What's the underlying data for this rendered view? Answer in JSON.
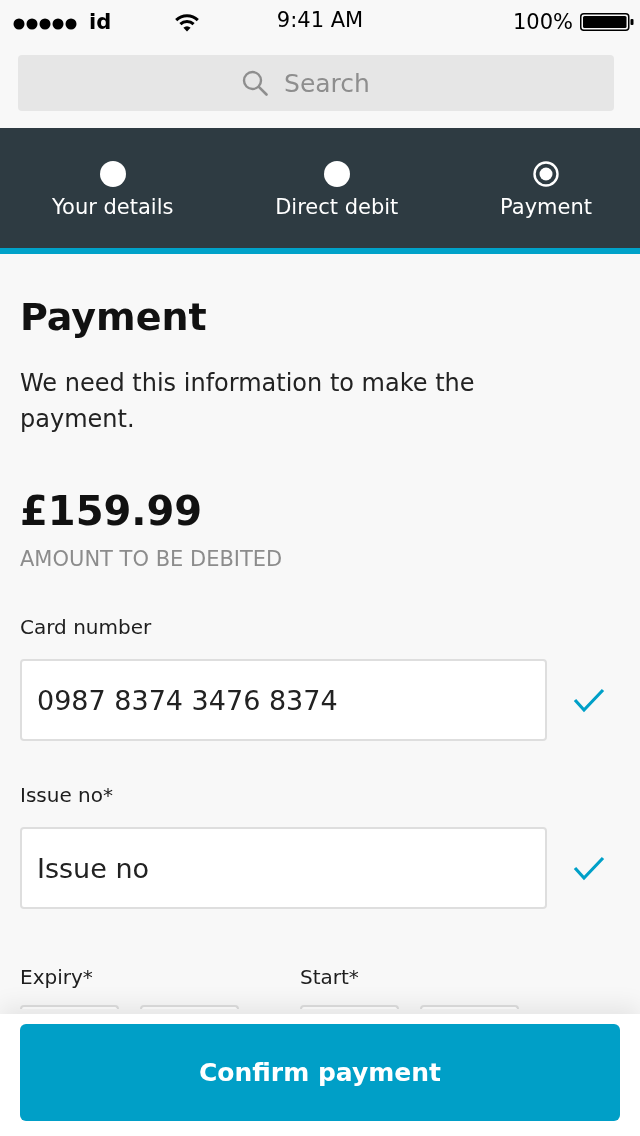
{
  "status_bar": {
    "carrier": "id",
    "time": "9:41 AM",
    "battery": "100%"
  },
  "search": {
    "placeholder": "Search"
  },
  "steps": [
    {
      "label": "Your details",
      "selected": false
    },
    {
      "label": "Direct debit",
      "selected": false
    },
    {
      "label": "Payment",
      "selected": true
    }
  ],
  "page": {
    "title": "Payment",
    "description": "We need this information to make the payment.",
    "amount": "£159.99",
    "amount_label": "AMOUNT TO BE DEBITED"
  },
  "fields": [
    {
      "label": "Card number",
      "value": "0987 8374 3476 8374",
      "valid": true
    },
    {
      "label": "Issue no*",
      "value": "Issue no",
      "valid": true
    }
  ],
  "date_groups": [
    {
      "label": "Expiry*"
    },
    {
      "label": "Start*"
    }
  ],
  "button": {
    "label": "Confirm payment"
  }
}
